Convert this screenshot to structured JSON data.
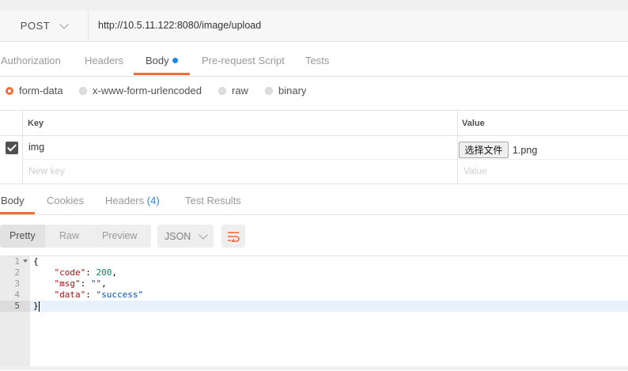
{
  "request": {
    "method": "POST",
    "url": "http://10.5.11.122:8080/image/upload"
  },
  "request_tabs": [
    "Authorization",
    "Headers",
    "Body",
    "Pre-request Script",
    "Tests"
  ],
  "body_types": [
    "form-data",
    "x-www-form-urlencoded",
    "raw",
    "binary"
  ],
  "form_table": {
    "headers": {
      "key": "Key",
      "value": "Value"
    },
    "rows": [
      {
        "checked": true,
        "key": "img",
        "file_button": "选择文件",
        "file_name": "1.png"
      }
    ],
    "placeholders": {
      "key": "New key",
      "value": "Value"
    }
  },
  "response_tabs": {
    "body": "Body",
    "cookies": "Cookies",
    "headers": "Headers",
    "headers_count": "(4)",
    "test_results": "Test Results"
  },
  "format": {
    "modes": [
      "Pretty",
      "Raw",
      "Preview"
    ],
    "language": "JSON"
  },
  "response_code": {
    "line_numbers": [
      "1",
      "2",
      "3",
      "4",
      "5"
    ],
    "open_brace": "{",
    "close_brace": "}",
    "code_key": "\"code\"",
    "code_value": "200",
    "msg_key": "\"msg\"",
    "msg_value": "\"\"",
    "data_key": "\"data\"",
    "data_value": "\"success\""
  },
  "colors": {
    "accent": "#f26b3a",
    "badge_blue": "#1e88e5"
  },
  "icons": [
    "chevron-down-icon",
    "checkbox-checked-icon",
    "wrap-lines-icon",
    "fold-arrow-icon"
  ]
}
